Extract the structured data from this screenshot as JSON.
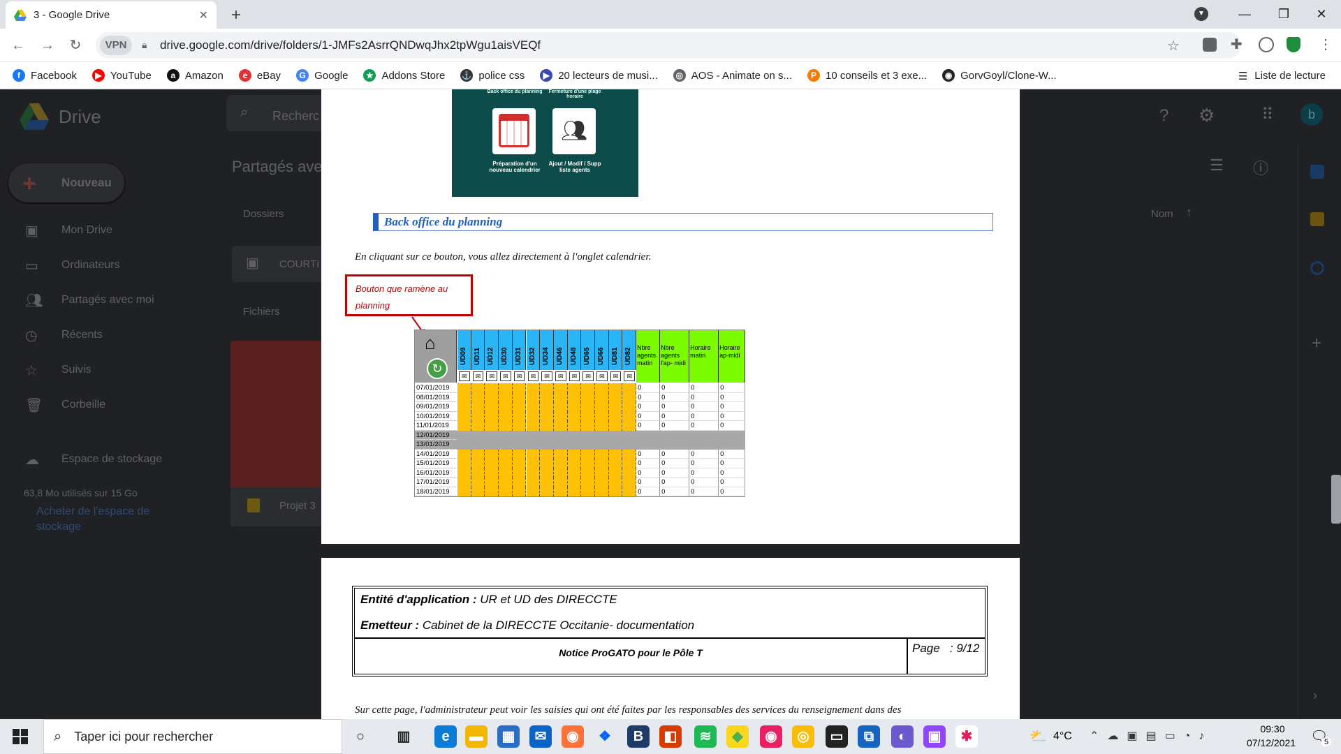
{
  "browser": {
    "tab_title": "3 - Google Drive",
    "new_tab_symbol": "+",
    "url": "drive.google.com/drive/folders/1-JMFs2AsrrQNDwqJhx2tpWgu1aisVEQf",
    "vpn_label": "VPN",
    "bookmarks": [
      {
        "label": "Facebook",
        "icon": "facebook-icon",
        "color": "#1877f2",
        "glyph": "f"
      },
      {
        "label": "YouTube",
        "icon": "youtube-icon",
        "color": "#ff0000",
        "glyph": "▶"
      },
      {
        "label": "Amazon",
        "icon": "amazon-icon",
        "color": "#111",
        "glyph": "a"
      },
      {
        "label": "eBay",
        "icon": "ebay-icon",
        "color": "#e53238",
        "glyph": "e"
      },
      {
        "label": "Google",
        "icon": "google-icon",
        "color": "#4285f4",
        "glyph": "G"
      },
      {
        "label": "Addons Store",
        "icon": "addons-store-icon",
        "color": "#0f9d58",
        "glyph": "★"
      },
      {
        "label": "police css",
        "icon": "anchor-icon",
        "color": "#333",
        "glyph": "⚓"
      },
      {
        "label": "20 lecteurs de musi...",
        "icon": "player-icon",
        "color": "#3949ab",
        "glyph": "▶"
      },
      {
        "label": "AOS - Animate on s...",
        "icon": "globe-icon",
        "color": "#5f6368",
        "glyph": "◎"
      },
      {
        "label": "10 conseils et 3 exe...",
        "icon": "p-icon",
        "color": "#f57c00",
        "glyph": "P"
      },
      {
        "label": "GorvGoyl/Clone-W...",
        "icon": "github-icon",
        "color": "#222",
        "glyph": "◉"
      }
    ],
    "reading_list": "Liste de lecture"
  },
  "drive": {
    "app_name": "Drive",
    "search_placeholder": "Recherc",
    "new_button": "Nouveau",
    "nav": [
      "Mon Drive",
      "Ordinateurs",
      "Partagés avec moi",
      "Récents",
      "Suivis",
      "Corbeille",
      "Espace de stockage"
    ],
    "storage_used": "63,8 Mo utilisés sur 15 Go",
    "buy_storage": "Acheter de l'espace de stockage",
    "page_title": "Partagés ave",
    "section_folders": "Dossiers",
    "section_files": "Fichiers",
    "folder_name": "COURTI",
    "file_name": "Projet 3",
    "sort_label": "Nom",
    "user_initial": "b"
  },
  "doc": {
    "image_caption_1": "Préparation d'un nouveau calendrier",
    "image_caption_2": "Ajout / Modif / Supp liste agents",
    "image_top_1": "Back office du planning",
    "image_top_2": "Fermeture d'une plage horaire",
    "heading": "Back office du planning",
    "paragraph": "En cliquant sur ce bouton, vous allez directement à l'onglet calendrier.",
    "callout": "Bouton que ramène au planning",
    "ud_columns": [
      "UD09",
      "UD11",
      "UD12",
      "UD30",
      "UD31",
      "UD32",
      "UD34",
      "UD46",
      "UD48",
      "UD65",
      "UD66",
      "UD81",
      "UD82"
    ],
    "green_columns": [
      "Nbre agents matin",
      "Nbre agents l'ap- midi",
      "Horaire matin",
      "Horaire ap-midi"
    ],
    "dates": [
      "07/01/2019",
      "08/01/2019",
      "09/01/2019",
      "10/01/2019",
      "11/01/2019",
      "12/01/2019",
      "13/01/2019",
      "14/01/2019",
      "15/01/2019",
      "16/01/2019",
      "17/01/2019",
      "18/01/2019"
    ],
    "weekend_rows": [
      5,
      6
    ],
    "zero": "0",
    "footer_entity_label": "Entité d'application :",
    "footer_entity_value": "UR et UD des DIRECCTE",
    "footer_emitter_label": "Emetteur :",
    "footer_emitter_value": "Cabinet de la DIRECCTE Occitanie- documentation",
    "footer_notice": "Notice ProGATO pour le Pôle T",
    "footer_page": "Page   : 9/12",
    "next_paragraph": "Sur cette page, l'administrateur peut voir les saisies qui ont été faites par les responsables des services du renseignement dans des"
  },
  "taskbar": {
    "search_placeholder": "Taper ici pour rechercher",
    "weather": "4°C",
    "time": "09:30",
    "date": "07/12/2021",
    "notif_count": "5"
  },
  "colors": {
    "teal": "#0d4a4a",
    "ud_blue": "#29b6f6",
    "yellow": "#ffc107",
    "green": "#7cfc00",
    "callout_red": "#c00000",
    "heading_blue": "#1f5fbf"
  }
}
